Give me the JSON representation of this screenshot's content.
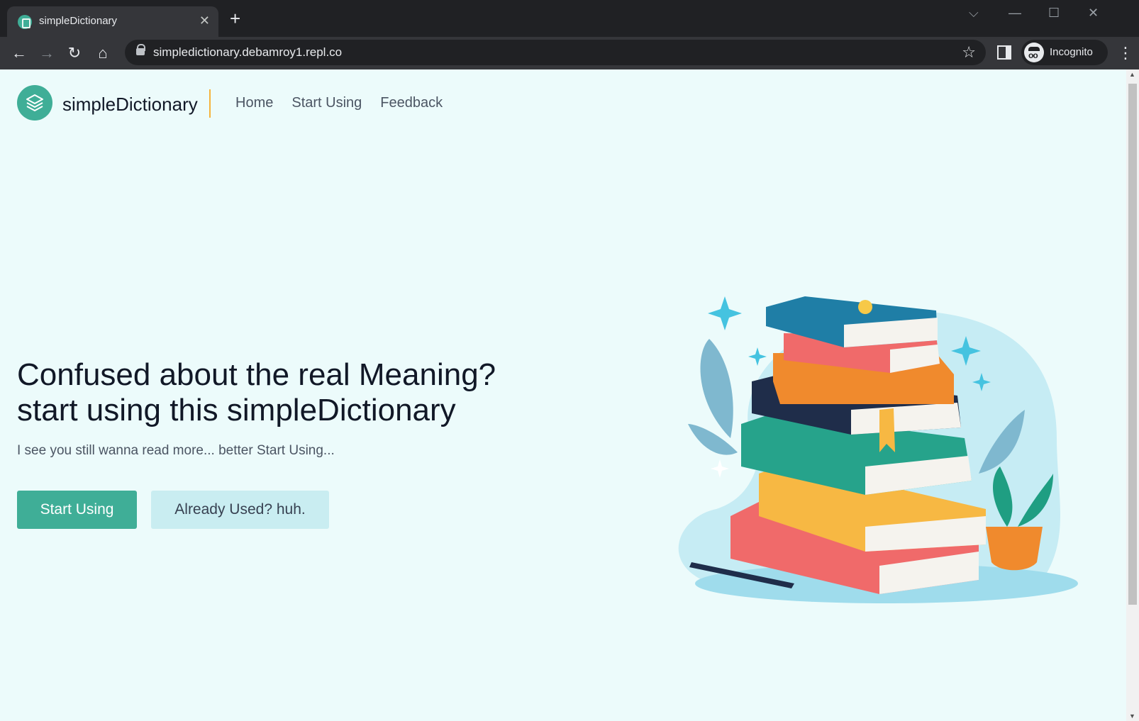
{
  "browser": {
    "tab_title": "simpleDictionary",
    "tab_close": "✕",
    "new_tab": "+",
    "url": "simpledictionary.debamroy1.repl.co",
    "profile_label": "Incognito"
  },
  "header": {
    "brand": "simpleDictionary",
    "nav": [
      "Home",
      "Start Using",
      "Feedback"
    ]
  },
  "hero": {
    "title_line1": "Confused about the real Meaning?",
    "title_line2": "start using this simpleDictionary",
    "subtitle": "I see you still wanna read more... better Start Using...",
    "primary_button": "Start Using",
    "secondary_button": "Already Used? huh."
  },
  "colors": {
    "accent": "#3fae97",
    "divider": "#f6b33c",
    "page_bg": "#ecfbfb",
    "secondary_button_bg": "#c9edf1"
  },
  "icons": [
    "layers-icon",
    "books-illustration",
    "star-icon",
    "lock-icon",
    "incognito-icon"
  ]
}
